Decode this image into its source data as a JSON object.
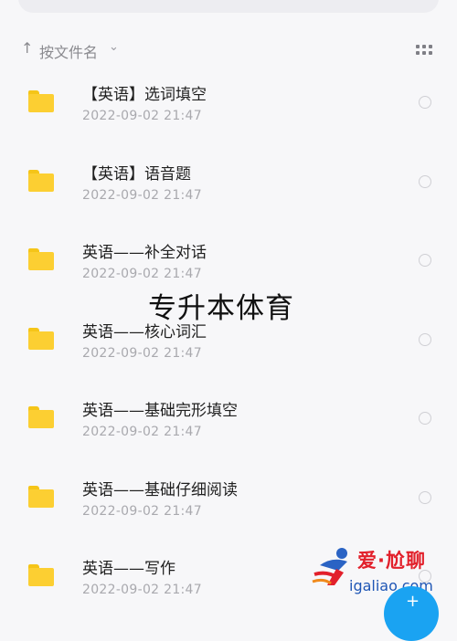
{
  "sort": {
    "arrow": "↑",
    "label": "按文件名",
    "chevron": "⌄"
  },
  "view_icon": "grid-icon",
  "files": [
    {
      "name": "【英语】选词填空",
      "date": "2022-09-02  21:47"
    },
    {
      "name": "【英语】语音题",
      "date": "2022-09-02  21:47"
    },
    {
      "name": "英语——补全对话",
      "date": "2022-09-02  21:47"
    },
    {
      "name": "英语——核心词汇",
      "date": "2022-09-02  21:47"
    },
    {
      "name": "英语——基础完形填空",
      "date": "2022-09-02  21:47"
    },
    {
      "name": "英语——基础仔细阅读",
      "date": "2022-09-02  21:47"
    },
    {
      "name": "英语——写作",
      "date": "2022-09-02  21:47"
    }
  ],
  "overlay_text": "专升本体育",
  "watermark": {
    "title": "爱·尬聊",
    "domain": "igaliao.com"
  },
  "fab": {
    "icon": "plus-icon",
    "color": "#1aa3f2"
  },
  "colors": {
    "folder": "#fccf32",
    "background": "#f7f7f9"
  }
}
